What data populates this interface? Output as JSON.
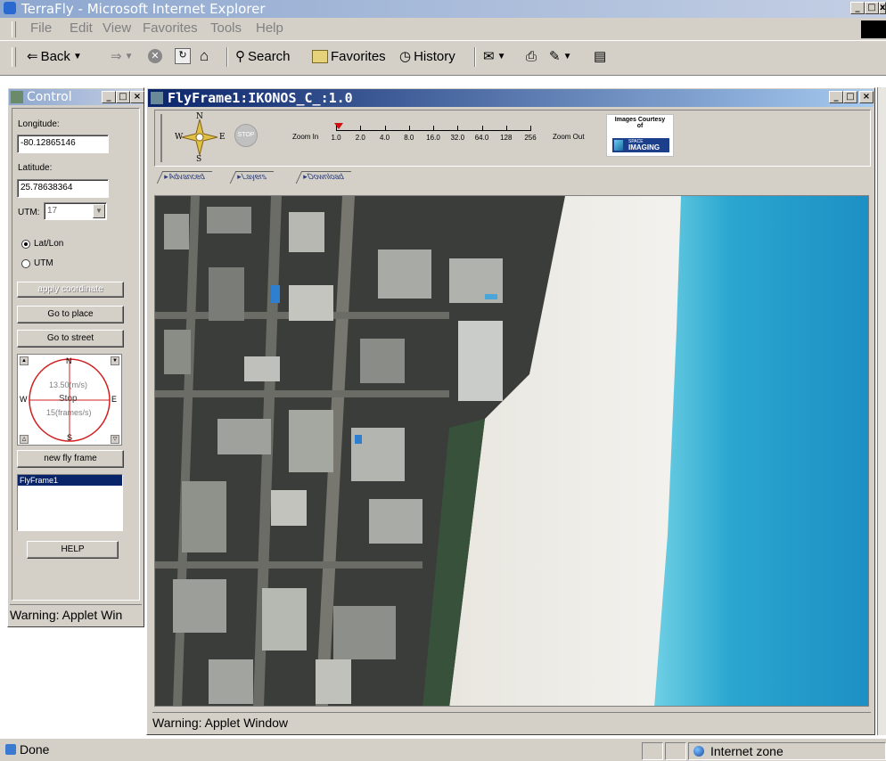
{
  "browser": {
    "title": "TerraFly - Microsoft Internet Explorer",
    "menu": [
      "File",
      "Edit",
      "View",
      "Favorites",
      "Tools",
      "Help"
    ],
    "toolbar": {
      "back": "Back",
      "search": "Search",
      "favorites": "Favorites",
      "history": "History"
    },
    "status": {
      "left": "Done",
      "zone": "Internet zone"
    }
  },
  "control": {
    "title": "Control",
    "longitude_label": "Longitude:",
    "longitude_value": "-80.12865146",
    "latitude_label": "Latitude:",
    "latitude_value": "25.78638364",
    "utm_label": "UTM:",
    "utm_value": "17",
    "radio_latlon": "Lat/Lon",
    "radio_utm": "UTM",
    "apply": "apply coordinate",
    "goto_place": "Go to place",
    "goto_street": "Go to street",
    "compass": {
      "n": "N",
      "s": "S",
      "e": "E",
      "w": "W",
      "speed": "13.50(m/s)",
      "stop": "Stop",
      "frames": "15(frames/s)"
    },
    "new_fly_frame": "new fly frame",
    "frames": [
      "FlyFrame1"
    ],
    "help": "HELP",
    "warning": "Warning: Applet Win"
  },
  "flyframe": {
    "title": "FlyFrame1:IKONOS_C_:1.0",
    "compass": {
      "n": "N",
      "s": "S",
      "e": "E",
      "w": "W"
    },
    "stop": "STOP",
    "zoom_in": "Zoom In",
    "zoom_out": "Zoom Out",
    "zoom_levels": [
      "1.0",
      "2.0",
      "4.0",
      "8.0",
      "16.0",
      "32.0",
      "64.0",
      "128",
      "256"
    ],
    "zoom_current": "1.0",
    "courtesy": {
      "line1": "Images Courtesy",
      "line2": "of",
      "brand_top": "SPACE",
      "brand_bottom": "IMAGING"
    },
    "tabs": [
      "Advanced",
      "Layers",
      "Download"
    ],
    "warning": "Warning: Applet Window"
  }
}
